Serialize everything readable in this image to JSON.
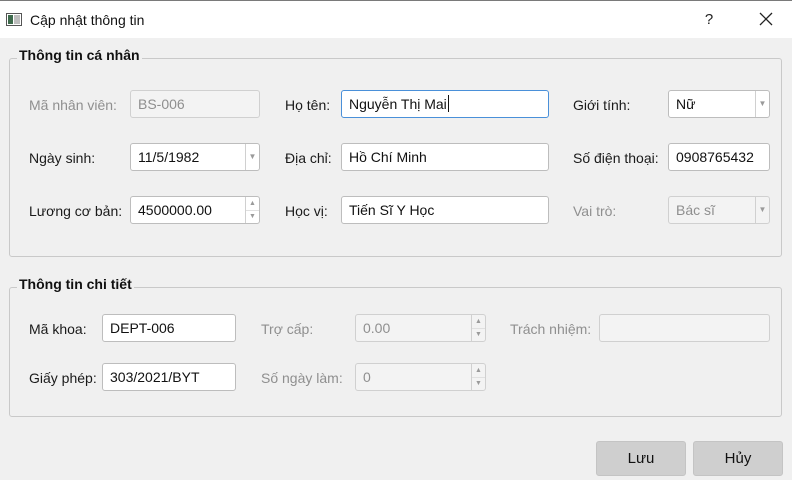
{
  "window": {
    "title": "Cập nhật thông tin",
    "help_label": "?"
  },
  "personal": {
    "group_title": "Thông tin cá nhân",
    "employee_id": {
      "label": "Mã nhân viên:",
      "value": "BS-006",
      "enabled": false
    },
    "full_name": {
      "label": "Họ tên:",
      "value": "Nguyễn Thị Mai"
    },
    "gender": {
      "label": "Giới tính:",
      "value": "Nữ"
    },
    "birth_date": {
      "label": "Ngày sinh:",
      "value": "11/5/1982"
    },
    "address": {
      "label": "Địa chỉ:",
      "value": "Hồ Chí Minh"
    },
    "phone": {
      "label": "Số điện thoại:",
      "value": "0908765432"
    },
    "base_salary": {
      "label": "Lương cơ bản:",
      "value": "4500000.00"
    },
    "degree": {
      "label": "Học vị:",
      "value": "Tiến Sĩ Y Học"
    },
    "role": {
      "label": "Vai trò:",
      "value": "Bác sĩ",
      "enabled": false
    }
  },
  "details": {
    "group_title": "Thông tin chi tiết",
    "department_id": {
      "label": "Mã khoa:",
      "value": "DEPT-006"
    },
    "allowance": {
      "label": "Trợ cấp:",
      "value": "0.00",
      "enabled": false
    },
    "responsibility": {
      "label": "Trách nhiệm:",
      "value": "",
      "enabled": false
    },
    "license": {
      "label": "Giấy phép:",
      "value": "303/2021/BYT"
    },
    "working_days": {
      "label": "Số ngày làm:",
      "value": "0",
      "enabled": false
    }
  },
  "buttons": {
    "save_label": "Lưu",
    "cancel_label": "Hủy"
  },
  "icons": {
    "app": "app-window-icon",
    "close": "close-icon",
    "dropdown": "chevron-down-icon",
    "spin_up": "spin-up-arrow-icon",
    "spin_down": "spin-down-arrow-icon"
  },
  "colors": {
    "background": "#f0f0f0",
    "focus_border": "#4a90d9",
    "disabled_text": "#8f8f8f",
    "button_bg": "#cfcfcf"
  }
}
